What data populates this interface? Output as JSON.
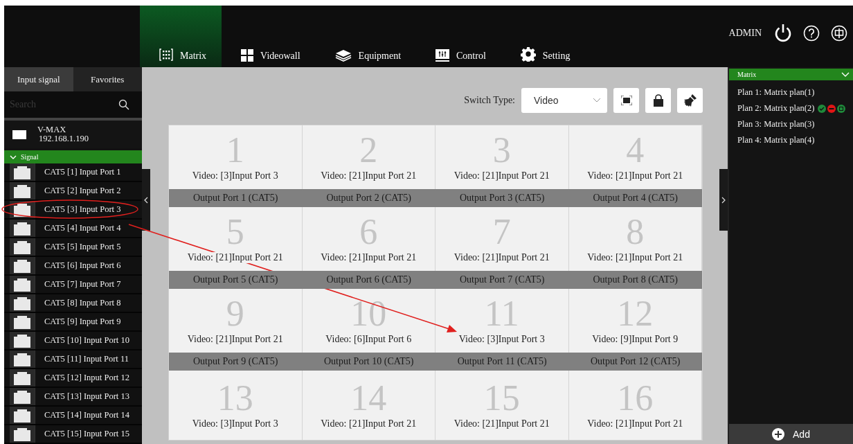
{
  "nav": {
    "tabs": [
      {
        "label": "Matrix",
        "kind": "grid",
        "selected": true
      },
      {
        "label": "Videowall",
        "kind": "tiles",
        "selected": false
      },
      {
        "label": "Equipment",
        "kind": "layers",
        "selected": false
      },
      {
        "label": "Control",
        "kind": "sliders",
        "selected": false
      },
      {
        "label": "Setting",
        "kind": "gear",
        "selected": false
      }
    ],
    "user": "ADMIN"
  },
  "sidebar": {
    "tabs": [
      {
        "label": "Input signal",
        "selected": true
      },
      {
        "label": "Favorites",
        "selected": false
      }
    ],
    "search": {
      "placeholder": "Search"
    },
    "device": {
      "name": "V-MAX",
      "ip": "192.168.1.190"
    },
    "group": {
      "label": "Signal",
      "expanded": true,
      "items": [
        {
          "label": "CAT5 [1] Input Port 1",
          "highlighted": false
        },
        {
          "label": "CAT5 [2] Input Port 2",
          "highlighted": false
        },
        {
          "label": "CAT5 [3] Input Port 3",
          "highlighted": true
        },
        {
          "label": "CAT5 [4] Input Port 4",
          "highlighted": false
        },
        {
          "label": "CAT5 [5] Input Port 5",
          "highlighted": false
        },
        {
          "label": "CAT5 [6] Input Port 6",
          "highlighted": false
        },
        {
          "label": "CAT5 [7] Input Port 7",
          "highlighted": false
        },
        {
          "label": "CAT5 [8] Input Port 8",
          "highlighted": false
        },
        {
          "label": "CAT5 [9] Input Port 9",
          "highlighted": false
        },
        {
          "label": "CAT5 [10] Input Port 10",
          "highlighted": false
        },
        {
          "label": "CAT5 [11] Input Port 11",
          "highlighted": false
        },
        {
          "label": "CAT5 [12] Input Port 12",
          "highlighted": false
        },
        {
          "label": "CAT5 [13] Input Port 13",
          "highlighted": false
        },
        {
          "label": "CAT5 [14] Input Port 14",
          "highlighted": false
        },
        {
          "label": "CAT5 [15] Input Port 15",
          "highlighted": false
        }
      ]
    }
  },
  "toolbar": {
    "switch_type_label": "Switch Type:",
    "switch_type": "Video"
  },
  "outputs": [
    {
      "number": "1",
      "source": "Video: [3]Input Port 3",
      "label": "Output Port 1 (CAT5)"
    },
    {
      "number": "2",
      "source": "Video: [21]Input Port 21",
      "label": "Output Port 2 (CAT5)"
    },
    {
      "number": "3",
      "source": "Video: [21]Input Port 21",
      "label": "Output Port 3 (CAT5)"
    },
    {
      "number": "4",
      "source": "Video: [21]Input Port 21",
      "label": "Output Port 4 (CAT5)"
    },
    {
      "number": "5",
      "source": "Video: [21]Input Port 21",
      "label": "Output Port 5 (CAT5)"
    },
    {
      "number": "6",
      "source": "Video: [21]Input Port 21",
      "label": "Output Port 6 (CAT5)"
    },
    {
      "number": "7",
      "source": "Video: [21]Input Port 21",
      "label": "Output Port 7 (CAT5)"
    },
    {
      "number": "8",
      "source": "Video: [21]Input Port 21",
      "label": "Output Port 8 (CAT5)"
    },
    {
      "number": "9",
      "source": "Video: [21]Input Port 21",
      "label": "Output Port 9 (CAT5)"
    },
    {
      "number": "10",
      "source": "Video: [6]Input Port 6",
      "label": "Output Port 10 (CAT5)"
    },
    {
      "number": "11",
      "source": "Video: [3]Input Port 3",
      "label": "Output Port 11 (CAT5)"
    },
    {
      "number": "12",
      "source": "Video: [9]Input Port 9",
      "label": "Output Port 12 (CAT5)"
    },
    {
      "number": "13",
      "source": "Video: [3]Input Port 3"
    },
    {
      "number": "14",
      "source": "Video: [21]Input Port 21"
    },
    {
      "number": "15",
      "source": "Video: [21]Input Port 21"
    },
    {
      "number": "16",
      "source": "Video: [21]Input Port 21"
    }
  ],
  "plans": {
    "title": "Matrix",
    "expanded": true,
    "items": [
      {
        "label": "Plan 1: Matrix plan(1)",
        "selected": false
      },
      {
        "label": "Plan 2: Matrix plan(2)",
        "selected": true
      },
      {
        "label": "Plan 3: Matrix plan(3)",
        "selected": false
      },
      {
        "label": "Plan 4: Matrix plan(4)",
        "selected": false
      }
    ],
    "add_button": "Add"
  }
}
